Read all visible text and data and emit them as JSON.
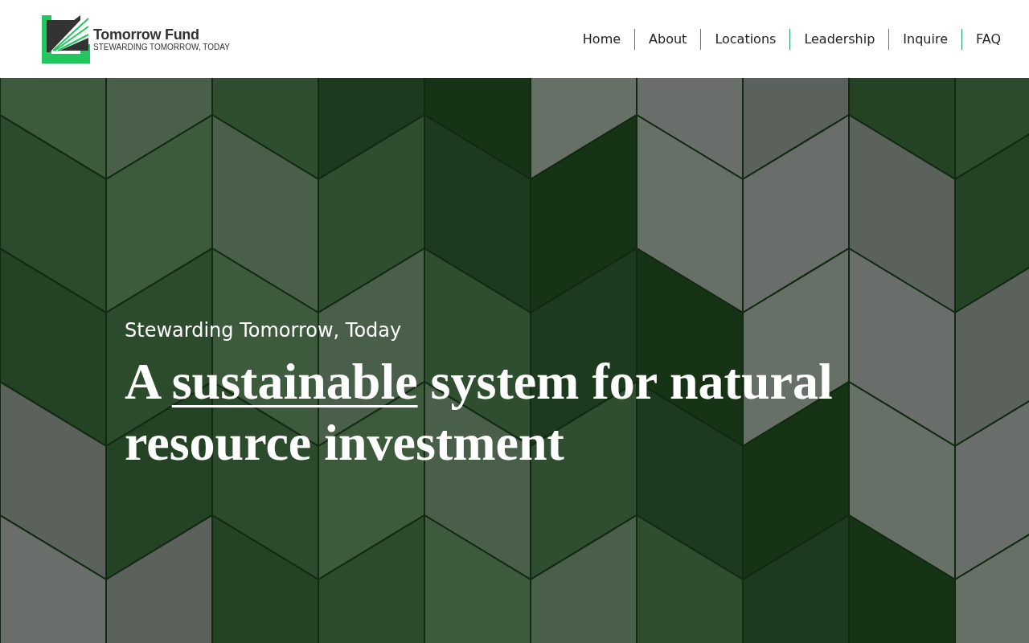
{
  "logo": {
    "name": "Tomorrow Fund",
    "tagline": "STEWARDING TOMORROW, TODAY"
  },
  "nav": [
    {
      "label": "Home"
    },
    {
      "label": "About"
    },
    {
      "label": "Locations"
    },
    {
      "label": "Leadership"
    },
    {
      "label": "Inquire"
    },
    {
      "label": "FAQ"
    }
  ],
  "hero": {
    "eyebrow": "Stewarding Tomorrow, Today",
    "heading": "A *sustainable* system for natural resource investment"
  }
}
